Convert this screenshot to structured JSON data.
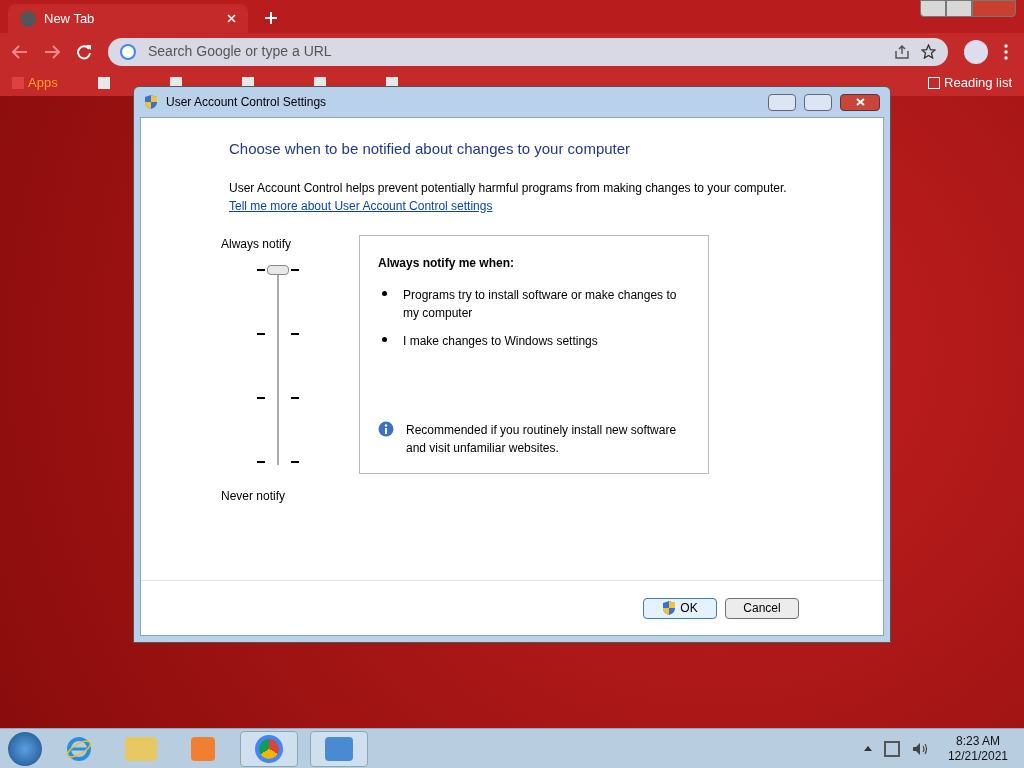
{
  "browser": {
    "tab": {
      "title": "New Tab",
      "selected": true
    },
    "omnibox": {
      "placeholder": "Search Google or type a URL"
    },
    "bookmarks": [
      "Apps"
    ],
    "reading_list": "Reading list"
  },
  "dialog": {
    "title": "User Account Control Settings",
    "heading": "Choose when to be notified about changes to your computer",
    "description": "User Account Control helps prevent potentially harmful programs from making changes to your computer.",
    "link": "Tell me more about User Account Control settings",
    "slider": {
      "top_label": "Always notify",
      "bottom_label": "Never notify",
      "level": 1
    },
    "info": {
      "title": "Always notify me when:",
      "bullets": [
        "Programs try to install software or make changes to my computer",
        "I make changes to Windows settings"
      ],
      "note": "Recommended if you routinely install new software and visit unfamiliar websites."
    },
    "buttons": [
      {
        "label": "OK",
        "kind": "primary"
      },
      {
        "label": "Cancel",
        "kind": "normal"
      }
    ]
  },
  "taskbar": {
    "time": "8:23 AM",
    "date": "12/21/2021"
  }
}
